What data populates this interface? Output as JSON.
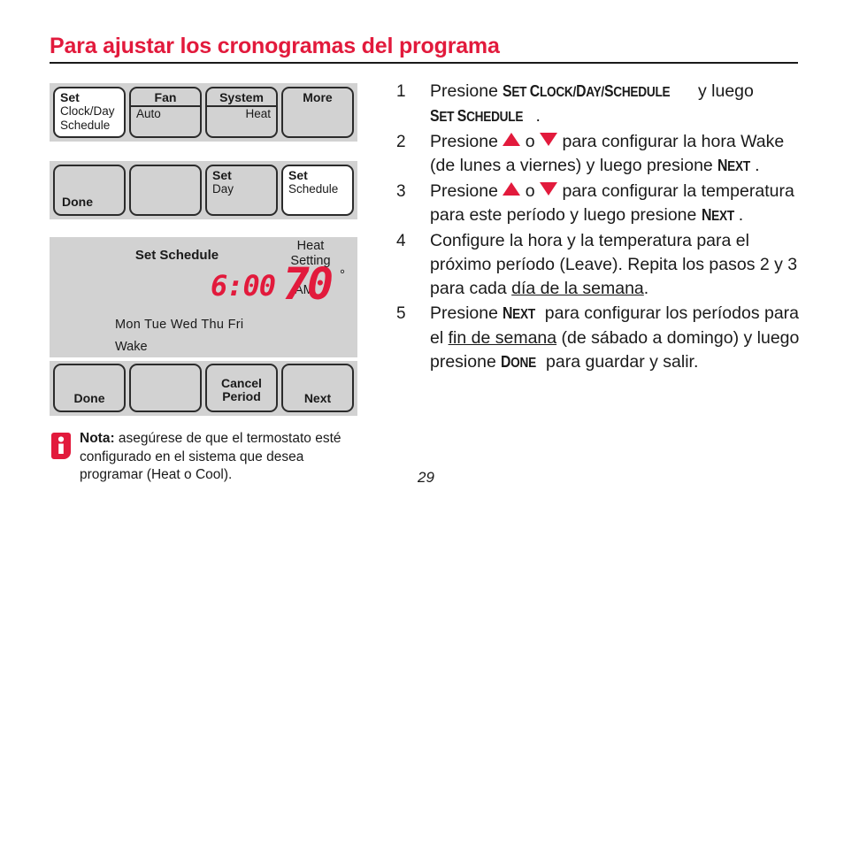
{
  "heading": "Para ajustar los cronogramas del programa",
  "thermostat": {
    "row1": [
      {
        "name": "set-clock-day-schedule",
        "header": "Set",
        "sub1": "Clock/Day",
        "sub2": "Schedule",
        "highlighted": true
      },
      {
        "name": "fan",
        "header": "Fan",
        "value": "Auto",
        "underline": true
      },
      {
        "name": "system",
        "header": "System",
        "value": "Heat",
        "underline": true
      },
      {
        "name": "more",
        "header": "More"
      }
    ],
    "row2": [
      {
        "name": "done",
        "bottom_label": "Done"
      },
      {
        "name": "blank"
      },
      {
        "name": "set-day",
        "header": "Set",
        "sub1": "Day"
      },
      {
        "name": "set-schedule",
        "header": "Set",
        "sub1": "Schedule",
        "highlighted": true
      }
    ],
    "row3": [
      {
        "name": "done",
        "bottom_label": "Done"
      },
      {
        "name": "blank"
      },
      {
        "name": "cancel-period",
        "bottom_label_1": "Cancel",
        "bottom_label_2": "Period"
      },
      {
        "name": "next",
        "bottom_label": "Next"
      }
    ],
    "lcd": {
      "title": "Set Schedule",
      "heat_label_line1": "Heat",
      "heat_label_line2": "Setting",
      "time": "6:00",
      "ampm": "AM",
      "temperature": "70",
      "degree": "°",
      "days": "Mon Tue Wed Thu Fri",
      "period": "Wake"
    }
  },
  "note": {
    "label": "Nota:",
    "text": " asegúrese de que el termostato esté configurado en el sistema que desea programar (Heat o Cool)."
  },
  "steps": [
    {
      "number": "1",
      "parts": [
        {
          "type": "text",
          "value": "Presione "
        },
        {
          "type": "kbd",
          "value": "Set Clock/Day/Schedule"
        },
        {
          "type": "text",
          "value": " y luego "
        },
        {
          "type": "kbd",
          "value": "Set Schedule"
        },
        {
          "type": "text",
          "value": "."
        }
      ]
    },
    {
      "number": "2",
      "parts": [
        {
          "type": "text",
          "value": "Presione "
        },
        {
          "type": "arrow-up",
          "value": "▲"
        },
        {
          "type": "text",
          "value": " o "
        },
        {
          "type": "arrow-down",
          "value": "▼"
        },
        {
          "type": "text",
          "value": " para configurar la hora Wake (de lunes a viernes) y luego presione "
        },
        {
          "type": "kbd",
          "value": "Next"
        },
        {
          "type": "text",
          "value": "."
        }
      ]
    },
    {
      "number": "3",
      "parts": [
        {
          "type": "text",
          "value": "Presione "
        },
        {
          "type": "arrow-up",
          "value": "▲"
        },
        {
          "type": "text",
          "value": " o "
        },
        {
          "type": "arrow-down",
          "value": "▼"
        },
        {
          "type": "text",
          "value": " para configurar la temperatura para este período y luego presione "
        },
        {
          "type": "kbd",
          "value": "Next"
        },
        {
          "type": "text",
          "value": "."
        }
      ]
    },
    {
      "number": "4",
      "parts": [
        {
          "type": "text",
          "value": "Configure la hora y la temperatura para el próximo período (Leave). Repita los pasos 2 y 3 para cada "
        },
        {
          "type": "underline",
          "value": "día de la semana"
        },
        {
          "type": "text",
          "value": "."
        }
      ]
    },
    {
      "number": "5",
      "parts": [
        {
          "type": "text",
          "value": "Presione "
        },
        {
          "type": "kbd",
          "value": "Next"
        },
        {
          "type": "text",
          "value": " para configurar los períodos para el "
        },
        {
          "type": "underline",
          "value": "fin de semana"
        },
        {
          "type": "text",
          "value": " (de sábado a domingo) y luego presione "
        },
        {
          "type": "kbd",
          "value": "Done"
        },
        {
          "type": "text",
          "value": " para guardar y salir."
        }
      ]
    }
  ],
  "page_number": "29",
  "colors": {
    "accent_red": "#E21A3C",
    "panel_gray": "#d2d2d2",
    "text_black": "#1a1a1a"
  }
}
